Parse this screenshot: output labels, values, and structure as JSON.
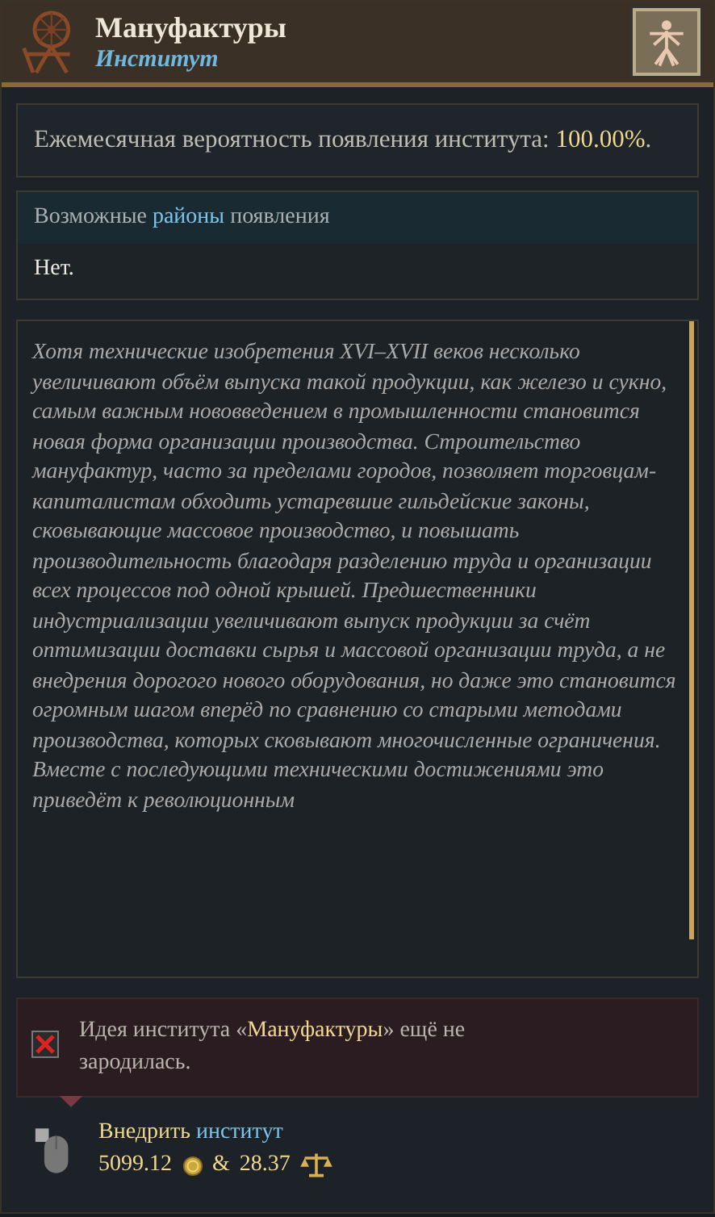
{
  "header": {
    "title": "Мануфактуры",
    "subtitle": "Институт"
  },
  "probability": {
    "label": "Ежемесячная вероятность появления института:",
    "value": "100.00%",
    "suffix": "."
  },
  "regions": {
    "heading": [
      {
        "text": "Возможные ",
        "kind": "plain"
      },
      {
        "text": "районы",
        "kind": "keyword"
      },
      {
        "text": " появления",
        "kind": "plain"
      }
    ],
    "value": "Нет."
  },
  "description": "Хотя технические изобретения XVI–XVII веков несколько увеличивают объём выпуска такой продукции, как железо и сукно, самым важным нововведением в промышленности становится новая форма организации производства. Строительство мануфактур, часто за пределами городов, позволяет торговцам-капиталистам обходить устаревшие гильдейские законы, сковывающие массовое производство, и повышать производительность благодаря разделению труда и организации всех процессов под одной крышей. Предшественники индустриализации увеличивают выпуск продукции за счёт оптимизации доставки сырья и массовой организации труда, а не внедрения дорогого нового оборудования, но даже это становится огромным шагом вперёд по сравнению со старыми методами производства, которых сковывают многочисленные ограничения. Вместе с последующими техническими достижениями это приведёт к революционным",
  "requirement": {
    "met": false,
    "parts": [
      {
        "text": "Идея института «",
        "kind": "plain"
      },
      {
        "text": "Мануфактуры",
        "kind": "highlight"
      },
      {
        "text": "» ещё не зародилась.",
        "kind": "plain"
      }
    ]
  },
  "action": {
    "label": [
      {
        "text": "Внедрить ",
        "kind": "highlight"
      },
      {
        "text": "институт",
        "kind": "keyword"
      }
    ],
    "gold": "5099.12",
    "joiner": "&",
    "points": "28.37"
  }
}
